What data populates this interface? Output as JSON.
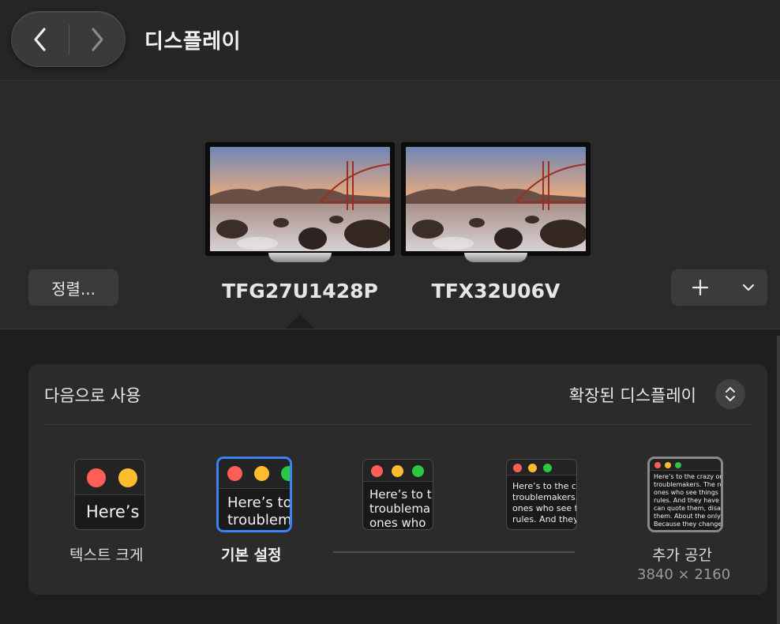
{
  "header": {
    "title": "디스플레이"
  },
  "displays": {
    "arrange_label": "정렬...",
    "monitors": [
      {
        "name": "TFG27U1428P"
      },
      {
        "name": "TFX32U06V"
      }
    ]
  },
  "settings": {
    "use_as_label": "다음으로 사용",
    "use_as_value": "확장된 디스플레이",
    "text_size_label": "텍스트 크게",
    "default_label": "기본 설정",
    "more_space_label": "추가 공간",
    "more_space_resolution": "3840 × 2160",
    "previews": {
      "p1_text": "Here’s",
      "p2_text_1": "Here’s to",
      "p2_text_2": "troublem",
      "p3_text_1": "Here’s to t",
      "p3_text_2": "troublema",
      "p3_text_3": "ones who",
      "p4_text_1": "Here’s to the cr",
      "p4_text_2": "troublemakers.",
      "p4_text_3": "ones who see t",
      "p4_text_4": "rules. And they",
      "p5_text_1": "Here’s to the crazy ones",
      "p5_text_2": "troublemakers. The rou",
      "p5_text_3": "ones who see things di",
      "p5_text_4": "rules. And they have no",
      "p5_text_5": "can quote them, disagre",
      "p5_text_6": "them. About the only th",
      "p5_text_7": "Because they change th"
    }
  },
  "colors": {
    "traffic_red": "#ff5f57",
    "traffic_yellow": "#febc2e",
    "traffic_green": "#28c840",
    "selection_blue": "#3b82f6"
  },
  "icons": {
    "back": "chevron-left-icon",
    "forward": "chevron-right-icon",
    "add": "plus-icon",
    "menu": "chevron-down-icon",
    "stepper": "up-down-chevron-icon"
  }
}
